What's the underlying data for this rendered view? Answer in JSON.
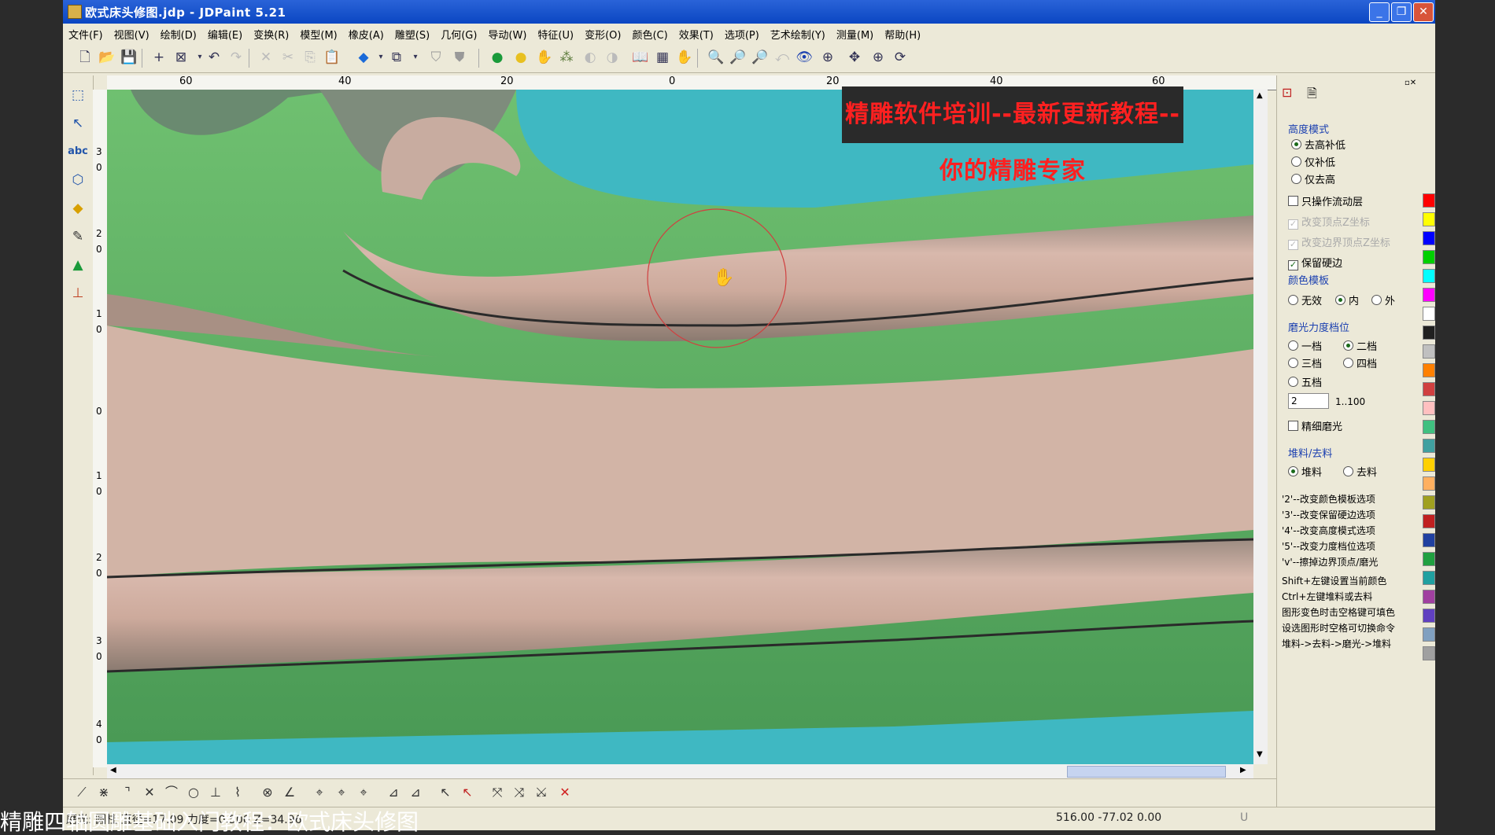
{
  "window": {
    "title": "欧式床头修图.jdp - JDPaint 5.21",
    "controls": [
      "_",
      "❐",
      "✕"
    ]
  },
  "menu": [
    "文件(F)",
    "视图(V)",
    "绘制(D)",
    "编辑(E)",
    "变换(R)",
    "模型(M)",
    "橡皮(A)",
    "雕塑(S)",
    "几何(G)",
    "导动(W)",
    "特征(U)",
    "变形(O)",
    "颜色(C)",
    "效果(T)",
    "选项(P)",
    "艺术绘制(Y)",
    "测量(M)",
    "帮助(H)"
  ],
  "ruler": {
    "unit": "mm",
    "top_ticks": [
      "60",
      "40",
      "20",
      "0",
      "20",
      "40",
      "60"
    ],
    "left_ticks": [
      "3",
      "0",
      "2",
      "0",
      "1",
      "0",
      "0",
      "1",
      "0",
      "2",
      "0",
      "3",
      "0",
      "4",
      "0"
    ]
  },
  "banner": "精雕软件培训--最新更新教程--你的精雕专家",
  "panel": {
    "height_mode_title": "高度模式",
    "height_modes": [
      {
        "label": "去高补低",
        "checked": true
      },
      {
        "label": "仅补低",
        "checked": false
      },
      {
        "label": "仅去高",
        "checked": false
      }
    ],
    "only_flow_layer": "只操作流动层",
    "change_vertex_z": "改变顶点Z坐标",
    "change_edge_vertex_z": "改变边界顶点Z坐标",
    "keep_hard_edge": "保留硬边",
    "color_template_title": "颜色模板",
    "color_template_opts": [
      {
        "label": "无效",
        "checked": false
      },
      {
        "label": "内",
        "checked": true
      },
      {
        "label": "外",
        "checked": false
      }
    ],
    "polish_force_title": "磨光力度档位",
    "polish_levels": [
      {
        "label": "一档",
        "checked": false
      },
      {
        "label": "二档",
        "checked": true
      },
      {
        "label": "三档",
        "checked": false
      },
      {
        "label": "四档",
        "checked": false
      },
      {
        "label": "五档",
        "checked": false
      }
    ],
    "level_value": "2",
    "level_range": "1..100",
    "fine_polish": "精细磨光",
    "material_title": "堆料/去料",
    "material_opts": [
      {
        "label": "堆料",
        "checked": true
      },
      {
        "label": "去料",
        "checked": false
      }
    ],
    "hints": [
      "'2'--改变颜色模板选项",
      "'3'--改变保留硬边选项",
      "'4'--改变高度模式选项",
      "'5'--改变力度档位选项",
      "'v'--擦掉边界顶点/磨光",
      "Shift+左键设置当前颜色",
      "Ctrl+左键堆料或去料",
      "图形变色时击空格键可填色",
      "设选图形时空格可切换命令",
      "堆料->去料->磨光->堆料"
    ]
  },
  "status": {
    "left": "磨光: 圆柱  直径=17.09  力度=0.500  Z=34.96",
    "coords": "516.00 -77.02 0.00",
    "mode": "U"
  },
  "caption": "精雕四轴圆雕基础入门教程：欧式床头修图",
  "swatch_colors": [
    "#ff0000",
    "#ffff00",
    "#0000ff",
    "#00d000",
    "#00ffff",
    "#ff00ff",
    "#ffffff",
    "#202020",
    "#c0c0c0",
    "#ff8000",
    "#d04040",
    "#ffc0c0",
    "#40c080",
    "#40a0a0",
    "#ffd000",
    "#ffb060",
    "#a0a020",
    "#c02020",
    "#2040a0",
    "#20a040",
    "#20a0a0",
    "#a040a0",
    "#6040c0",
    "#80a0c0",
    "#a0a0a0"
  ]
}
